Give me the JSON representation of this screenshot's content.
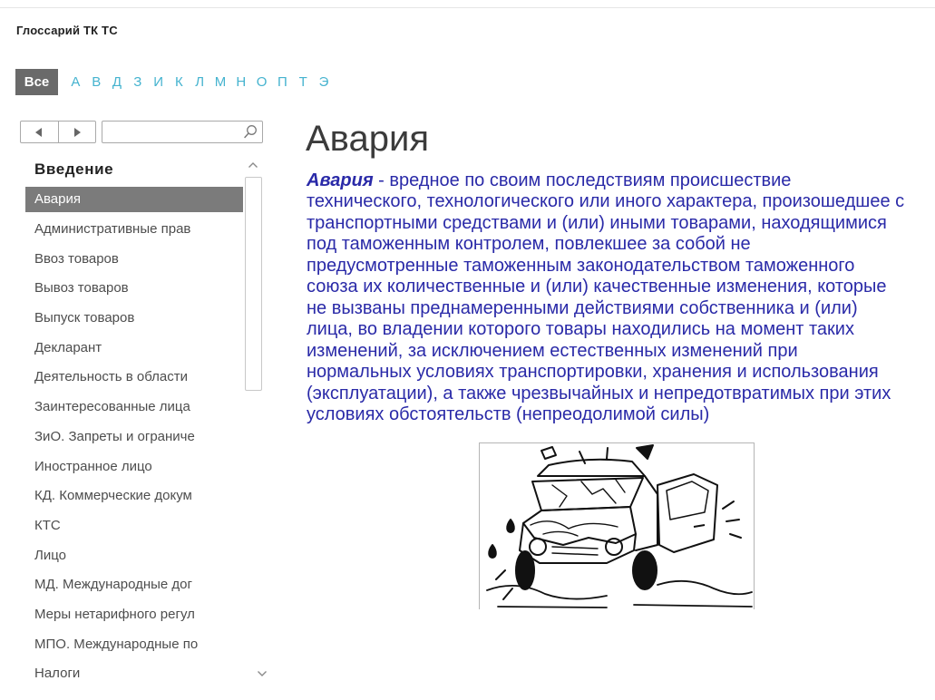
{
  "app": {
    "title": "Глоссарий ТК ТС"
  },
  "alphabet": {
    "all_label": "Все",
    "letters": [
      "А",
      "В",
      "Д",
      "З",
      "И",
      "К",
      "Л",
      "М",
      "Н",
      "О",
      "П",
      "Т",
      "Э"
    ]
  },
  "nav": {
    "back_icon": "triangle-left-icon",
    "forward_icon": "triangle-right-icon"
  },
  "search": {
    "icon": "search-icon"
  },
  "sidebar": {
    "section_title": "Введение",
    "selected_index": 0,
    "items": [
      "Авария",
      "Административные прав",
      "Ввоз товаров",
      "Вывоз товаров",
      "Выпуск товаров",
      "Декларант",
      "Деятельность в области",
      "Заинтересованные лица",
      "ЗиО. Запреты и ограниче",
      "Иностранное лицо",
      "КД. Коммерческие докум",
      "КТС",
      "Лицо",
      "МД. Международные дог",
      "Меры нетарифного регул",
      "МПО. Международные по",
      "Налоги"
    ],
    "scroll_icons": {
      "up": "chevron-up-icon",
      "down": "chevron-down-icon"
    }
  },
  "article": {
    "heading": "Авария",
    "term": "Авария",
    "definition_lines": [
      " - вредное по своим последствиям происшествие",
      "технического, технологического или иного характера, произошедшее с",
      "транспортными средствами и (или) иными товарами, находящимися",
      "под таможенным контролем, повлекшее за собой не",
      "предусмотренные таможенным законодательством таможенного",
      "союза их количественные и (или) качественные изменения, которые",
      "не вызваны преднамеренными действиями собственника и (или)",
      "лица, во владении которого товары находились на момент таких",
      "изменений, за исключением естественных изменений при",
      "нормальных условиях транспортировки, хранения и использования",
      "(эксплуатации), а также чрезвычайных и непредотвратимых при этих",
      "условиях обстоятельств (непреодолимой силы)"
    ],
    "illustration": "car-crash-illustration"
  },
  "colors": {
    "definition_text": "#2a2aa8",
    "alphabet_letter": "#45b3cf",
    "all_button_bg": "#6a6a6a",
    "selected_item_bg": "#7b7b7b"
  }
}
